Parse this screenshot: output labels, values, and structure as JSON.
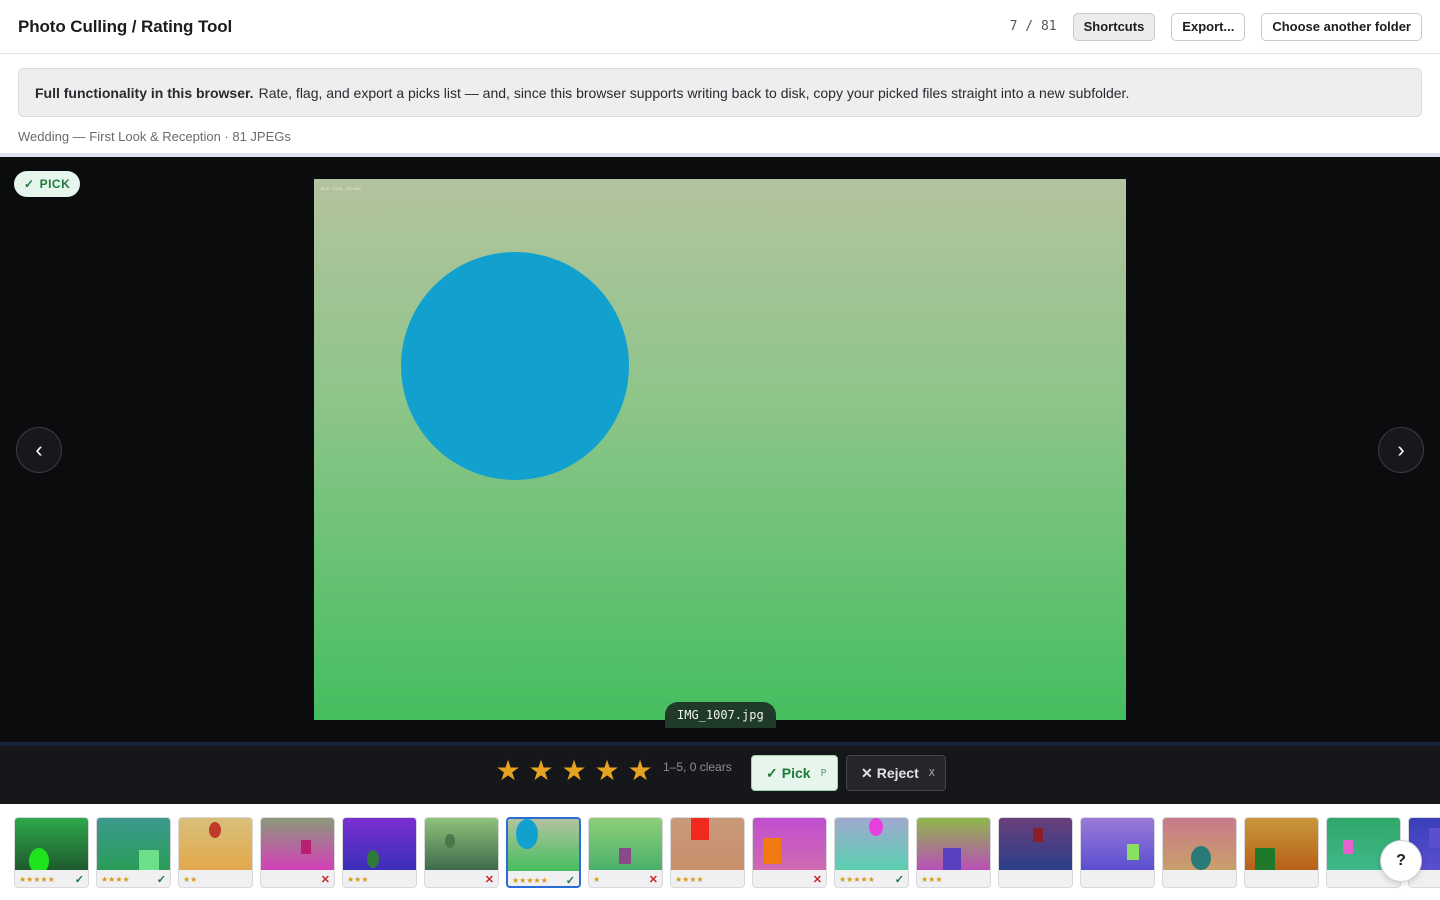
{
  "header": {
    "title": "Photo Culling / Rating Tool",
    "counter": "7 / 81",
    "shortcuts_label": "Shortcuts",
    "export_label": "Export...",
    "choose_folder_label": "Choose another folder"
  },
  "banner": {
    "bold": "Full functionality in this browser.",
    "text": "Rate, flag, and export a picks list — and, since this browser supports writing back to disk, copy your picked files straight into a new subfolder."
  },
  "album": "Wedding — First Look & Reception · 81 JPEGs",
  "viewer": {
    "badge": "PICK",
    "prev_icon": "‹",
    "next_icon": "›",
    "filename": "IMG_1007.jpg",
    "photo_meta": "f/2.8 · 1/125 · ISO 400",
    "photo_colors": {
      "sky": "#b3c39f",
      "ground": "#45be5f",
      "circle": "#12a1cf"
    }
  },
  "controls": {
    "star_glyph": "★",
    "star_count": 5,
    "star_hint": "1–5, 0 clears",
    "pick_label": "Pick",
    "pick_key": "P",
    "reject_label": "Reject",
    "reject_key": "X"
  },
  "filmstrip": [
    {
      "stars": "★★★★★",
      "flag": "pick",
      "bg": "linear-gradient(180deg,#2fa84c,#1e5a2e)",
      "shape": {
        "kind": "ellipse",
        "color": "#1ee31e"
      }
    },
    {
      "stars": "★★★★",
      "flag": "pick",
      "bg": "linear-gradient(180deg,#3c9a8e,#2a9c58)",
      "shape": {
        "kind": "rect",
        "color": "#6ee08a"
      }
    },
    {
      "stars": "★★",
      "flag": "",
      "bg": "linear-gradient(180deg,#d8c07a,#e3a84c)",
      "shape": {
        "kind": "ellipse",
        "color": "#c0392b"
      }
    },
    {
      "stars": "",
      "flag": "reject",
      "bg": "linear-gradient(180deg,#8a9a7a,#d43fb8)",
      "shape": {
        "kind": "rect",
        "color": "#b81f72"
      }
    },
    {
      "stars": "★★★",
      "flag": "",
      "bg": "linear-gradient(180deg,#7a2fd0,#3a2fb8)",
      "shape": {
        "kind": "ellipse",
        "color": "#2f7a3a"
      }
    },
    {
      "stars": "",
      "flag": "reject",
      "bg": "linear-gradient(180deg,#8fc27a,#3f6a4c)",
      "shape": {
        "kind": "ellipse",
        "color": "#4a7a4a"
      }
    },
    {
      "stars": "★★★★★",
      "flag": "pick",
      "bg": "linear-gradient(180deg,#b3c39f,#45be5f)",
      "shape": {
        "kind": "ellipse",
        "color": "#12a1cf"
      }
    },
    {
      "stars": "★",
      "flag": "reject",
      "bg": "linear-gradient(180deg,#8fcf7a,#4ab06a)",
      "shape": {
        "kind": "rect",
        "color": "#8a4a8a"
      }
    },
    {
      "stars": "★★★★",
      "flag": "",
      "bg": "linear-gradient(180deg,#c99a7a,#c88f6a)",
      "shape": {
        "kind": "rect",
        "color": "#f02a1e"
      }
    },
    {
      "stars": "",
      "flag": "reject",
      "bg": "linear-gradient(180deg,#c04fd0,#d06ab0)",
      "shape": {
        "kind": "rect",
        "color": "#f07a10"
      }
    },
    {
      "stars": "★★★★★",
      "flag": "pick",
      "bg": "linear-gradient(180deg,#a0a8d0,#5ad0b0)",
      "shape": {
        "kind": "ellipse",
        "color": "#e83fe0"
      }
    },
    {
      "stars": "★★★",
      "flag": "",
      "bg": "linear-gradient(180deg,#8fb84a,#b84fb8)",
      "shape": {
        "kind": "rect",
        "color": "#5a3fc0"
      }
    },
    {
      "stars": "",
      "flag": "",
      "bg": "linear-gradient(180deg,#6a3f7a,#2a3f8a)",
      "shape": {
        "kind": "rect",
        "color": "#8a1f2a"
      }
    },
    {
      "stars": "",
      "flag": "",
      "bg": "linear-gradient(180deg,#9a7ad8,#5a4fd0)",
      "shape": {
        "kind": "rect",
        "color": "#8ae060"
      }
    },
    {
      "stars": "",
      "flag": "",
      "bg": "linear-gradient(180deg,#c97a8a,#c8a06a)",
      "shape": {
        "kind": "ellipse",
        "color": "#2a7a7a"
      }
    },
    {
      "stars": "",
      "flag": "",
      "bg": "linear-gradient(180deg,#c8983a,#b8601a)",
      "shape": {
        "kind": "rect",
        "color": "#1e7a2a"
      }
    },
    {
      "stars": "",
      "flag": "",
      "bg": "linear-gradient(180deg,#2fa86a,#3fb88a)",
      "shape": {
        "kind": "rect",
        "color": "#e85fd0"
      }
    },
    {
      "stars": "",
      "flag": "",
      "bg": "linear-gradient(180deg,#3a3fb8,#5a4fd0)",
      "shape": {
        "kind": "rect",
        "color": "#5a4fd0"
      }
    }
  ],
  "help_label": "?"
}
